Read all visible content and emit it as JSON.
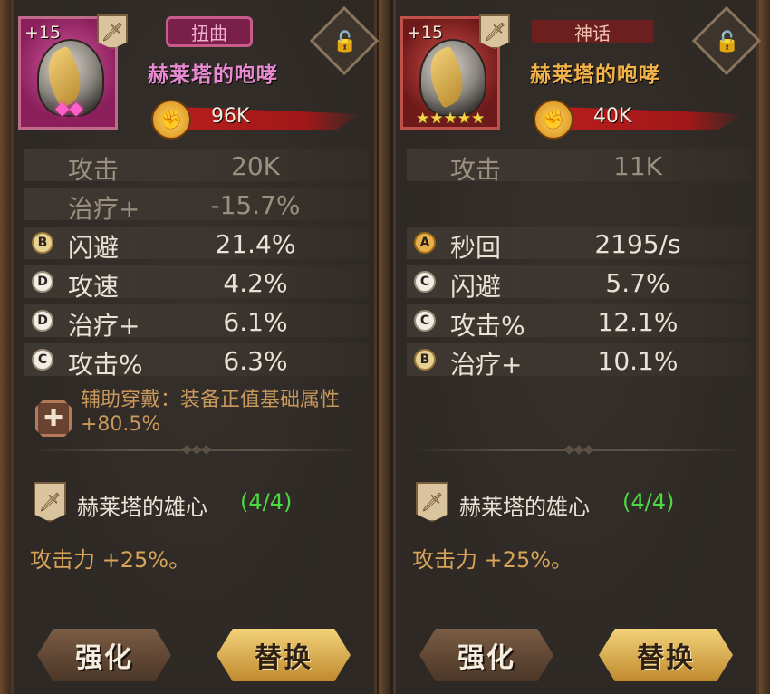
{
  "panels": [
    {
      "level": "+15",
      "grade": "扭曲",
      "name": "赫莱塔的咆哮",
      "power": "96K",
      "stars": "",
      "stats": [
        {
          "grade": "",
          "label": "攻击",
          "value": "20K",
          "dim": true
        },
        {
          "grade": "",
          "label": "治疗+",
          "value": "-15.7%",
          "dim": true
        },
        {
          "grade": "B",
          "label": "闪避",
          "value": "21.4%"
        },
        {
          "grade": "D",
          "label": "攻速",
          "value": "4.2%"
        },
        {
          "grade": "D",
          "label": "治疗+",
          "value": "6.1%"
        },
        {
          "grade": "C",
          "label": "攻击%",
          "value": "6.3%"
        }
      ],
      "aux_text": "辅助穿戴：装备正值基础属性 +80.5%",
      "set_name": "赫莱塔的雄心",
      "set_count": "(4/4)",
      "set_bonus": "攻击力 +25%。",
      "btn_enhance": "强化",
      "btn_replace": "替换"
    },
    {
      "level": "+15",
      "grade": "神话",
      "name": "赫莱塔的咆哮",
      "power": "40K",
      "stars": "★★★★★",
      "stats": [
        {
          "grade": "",
          "label": "攻击",
          "value": "11K",
          "dim": true
        },
        {
          "grade": "A",
          "label": "秒回",
          "value": "2195/s"
        },
        {
          "grade": "C",
          "label": "闪避",
          "value": "5.7%"
        },
        {
          "grade": "C",
          "label": "攻击%",
          "value": "12.1%"
        },
        {
          "grade": "B",
          "label": "治疗+",
          "value": "10.1%"
        }
      ],
      "set_name": "赫莱塔的雄心",
      "set_count": "(4/4)",
      "set_bonus": "攻击力 +25%。",
      "btn_enhance": "强化",
      "btn_replace": "替换"
    }
  ],
  "icons": {
    "type": "sword-icon",
    "lock": "unlocked-padlock-icon",
    "power": "fist-icon",
    "aux": "plus-cross-icon",
    "set": "sword-icon"
  },
  "colors": {
    "set_count": "#4ed846",
    "power_bar": "#b81d1d",
    "twisted_name": "#e88ad0",
    "mythic_name": "#f2b24a"
  }
}
